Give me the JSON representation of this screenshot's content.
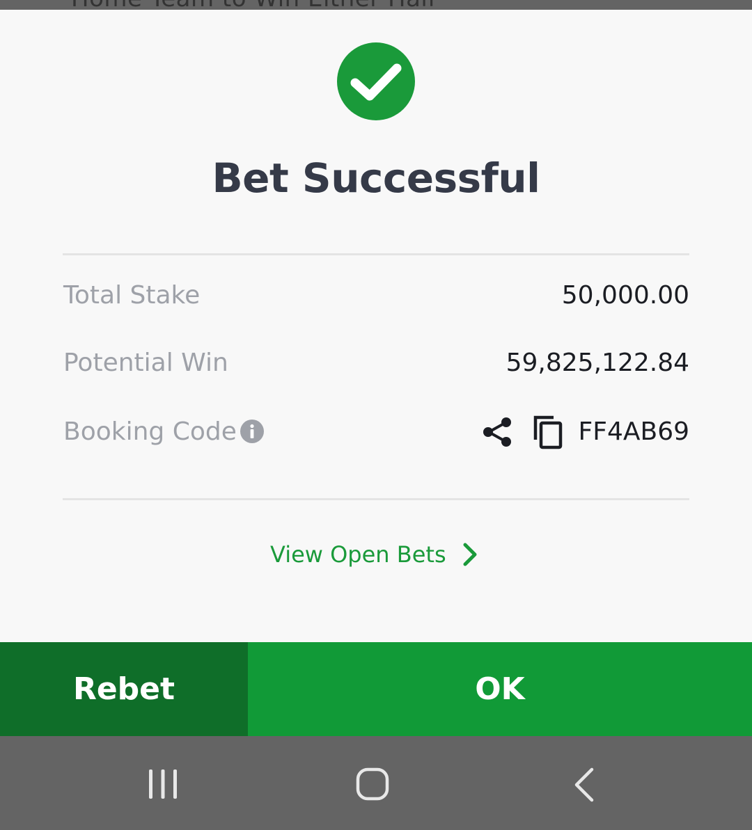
{
  "background": {
    "underlying_text": "Home Team to Win Either Half"
  },
  "dialog": {
    "title": "Bet Successful",
    "rows": [
      {
        "label": "Total Stake",
        "value": "50,000.00"
      },
      {
        "label": "Potential Win",
        "value": "59,825,122.84"
      },
      {
        "label": "Booking Code",
        "value": "FF4AB69"
      }
    ],
    "view_open_bets": "View Open Bets"
  },
  "buttons": {
    "rebet": "Rebet",
    "ok": "OK"
  },
  "icons": {
    "success": "check-circle-icon",
    "info": "info-icon",
    "share": "share-icon",
    "copy": "copy-icon",
    "chevron": "chevron-right-icon",
    "nav_recent": "recent-apps-icon",
    "nav_home": "home-icon",
    "nav_back": "back-icon"
  },
  "colors": {
    "accent_green": "#119a37",
    "dark_green": "#0f6e29",
    "success_circle": "#1a9a3a",
    "title_text": "#353a48",
    "label_text": "#9ea1a8",
    "value_text": "#1b1d23",
    "sheet_bg": "#f8f8f8",
    "navbar_bg": "#646464"
  }
}
